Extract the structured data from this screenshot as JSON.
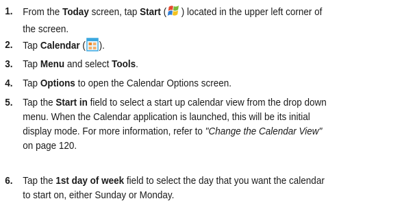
{
  "steps": [
    {
      "number": "1.",
      "line1_pre": "From the ",
      "today": "Today",
      "line1_mid": " screen, tap ",
      "start": "Start",
      "paren_open": " (",
      "icon": "windows-start-icon",
      "paren_close": ")",
      "line1_post": " located in the upper left corner of",
      "line2": "the screen."
    },
    {
      "number": "2.",
      "pre": "Tap ",
      "calendar": "Calendar",
      "paren_open": " (",
      "icon": "calendar-icon",
      "paren_close": ")."
    },
    {
      "number": "3.",
      "pre": "Tap ",
      "menu": "Menu",
      "mid": " and select ",
      "tools": "Tools",
      "post": "."
    },
    {
      "number": "4.",
      "pre": "Tap ",
      "options": "Options",
      "post": " to open the Calendar Options screen."
    },
    {
      "number": "5.",
      "pre": "Tap the ",
      "start_in": "Start in",
      "line1_post": " field to select a start up calendar view from the drop down",
      "line2": "menu. When the Calendar application is launched, this will be its initial",
      "line3_pre": "display mode. For more information, refer to ",
      "link": "\"Change the Calendar View\"",
      "line4": "on page 120."
    },
    {
      "number": "6.",
      "pre": "Tap the ",
      "first_day": "1st day of week",
      "line1_post": " field to select the day that you want the calendar",
      "line2": "to start on, either Sunday or Monday."
    }
  ],
  "colors": {
    "text": "#1a1a1a",
    "start_icon_red": "#e5492f",
    "start_icon_green": "#7ab93a",
    "start_icon_blue": "#2f7fd6",
    "start_icon_yellow": "#f4c21f",
    "calendar_icon_frame": "#3aa7df",
    "calendar_icon_accent": "#f08a2a"
  }
}
